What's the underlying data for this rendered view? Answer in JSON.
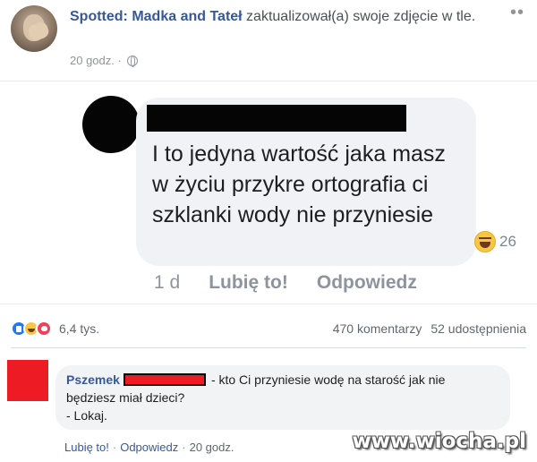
{
  "post": {
    "page_name": "Spotted: Madka and Tateł",
    "action_text": " zaktualizował(a) swoje zdjęcie w tle.",
    "time": "20 godz. ·",
    "more_icon": "more-dots-icon"
  },
  "photo": {
    "comment_text": "I to jedyna wartość jaka masz w życiu przykre ortografia ci szklanki wody nie przyniesie",
    "reaction_count": "26",
    "time": "1 d",
    "like_label": "Lubię to!",
    "reply_label": "Odpowiedz"
  },
  "reactions": {
    "count": "6,4 tys.",
    "comments": "470 komentarzy",
    "shares": "52 udostępnienia"
  },
  "comment": {
    "author": "Pszemek",
    "text_line1": "- kto Ci przyniesie wodę na starość jak nie będziesz miał dzieci?",
    "text_line2": "- Lokaj.",
    "like_label": "Lubię to!",
    "reply_label": "Odpowiedz",
    "time": "20 godz."
  },
  "watermark": "www.wiocha.pl",
  "colors": {
    "link": "#365899",
    "redaction_red": "#ed1c24",
    "bubble_bg": "#f1f2f6"
  }
}
